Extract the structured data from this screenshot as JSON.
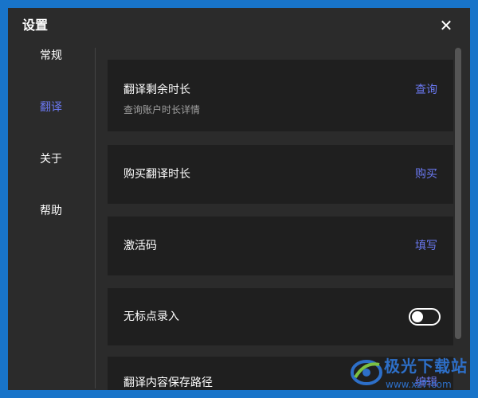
{
  "window": {
    "title": "设置",
    "close_icon": "close-icon"
  },
  "sidebar": {
    "items": [
      {
        "label": "常规",
        "active": false
      },
      {
        "label": "翻译",
        "active": true
      },
      {
        "label": "关于",
        "active": false
      },
      {
        "label": "帮助",
        "active": false
      }
    ]
  },
  "settings": {
    "remaining_time": {
      "title": "翻译剩余时长",
      "subtitle": "查询账户时长详情",
      "action": "查询"
    },
    "buy_time": {
      "title": "购买翻译时长",
      "action": "购买"
    },
    "activation_code": {
      "title": "激活码",
      "action": "填写"
    },
    "no_punctuation_input": {
      "title": "无标点录入",
      "enabled": false
    },
    "save_path": {
      "title": "翻译内容保存路径",
      "action": "编辑"
    }
  },
  "watermark": {
    "title": "极光下载站",
    "url": "www.xz7.com"
  },
  "colors": {
    "accent": "#6a78f0",
    "window_bg": "#2b2b2b",
    "card_bg": "#1f1f1f",
    "desktop_bg": "#1874c9"
  }
}
